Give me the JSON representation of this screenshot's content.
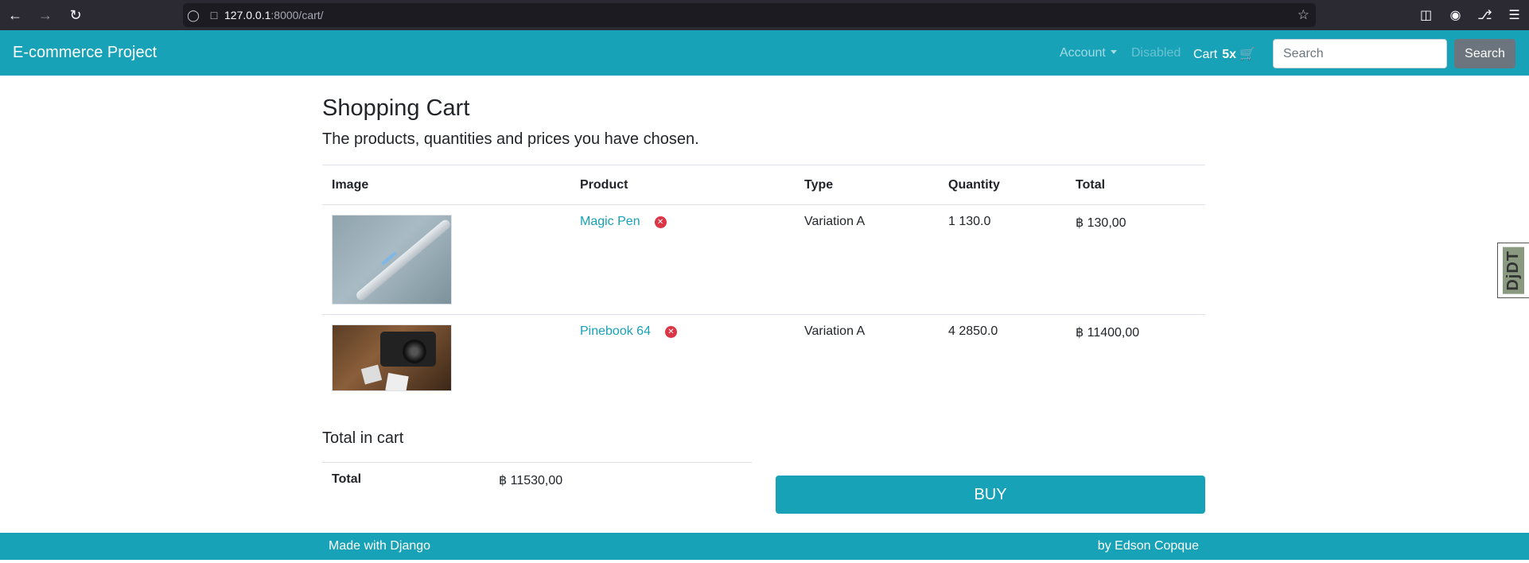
{
  "browser": {
    "url_host": "127.0.0.1",
    "url_path": ":8000/cart/",
    "icons": [
      "back-icon",
      "forward-icon",
      "reload-icon",
      "shield-icon",
      "page-icon",
      "star-icon",
      "pocket-icon",
      "account-icon",
      "extensions-icon",
      "menu-icon"
    ]
  },
  "navbar": {
    "brand": "E-commerce Project",
    "account": "Account",
    "disabled": "Disabled",
    "cart_label": "Cart",
    "cart_count": "5x",
    "search_placeholder": "Search",
    "search_button": "Search"
  },
  "page": {
    "title": "Shopping Cart",
    "lead": "The products, quantities and prices you have chosen."
  },
  "table": {
    "headers": [
      "Image",
      "Product",
      "Type",
      "Quantity",
      "Total"
    ],
    "rows": [
      {
        "product": "Magic Pen",
        "type": "Variation A",
        "quantity": "1 130.0",
        "total": "฿ 130,00",
        "image": "pen-photo"
      },
      {
        "product": "Pinebook 64",
        "type": "Variation A",
        "quantity": "4 2850.0",
        "total": "฿ 11400,00",
        "image": "camera-photo"
      }
    ]
  },
  "summary": {
    "title": "Total in cart",
    "label": "Total",
    "value": "฿ 11530,00",
    "buy": "BUY"
  },
  "footer": {
    "left": "Made with Django",
    "right": "by Edson Copque"
  },
  "debug_toolbar": "DjDT",
  "colors": {
    "primary": "#17a2b8",
    "danger": "#dc3545",
    "secondary": "#6c757d"
  }
}
